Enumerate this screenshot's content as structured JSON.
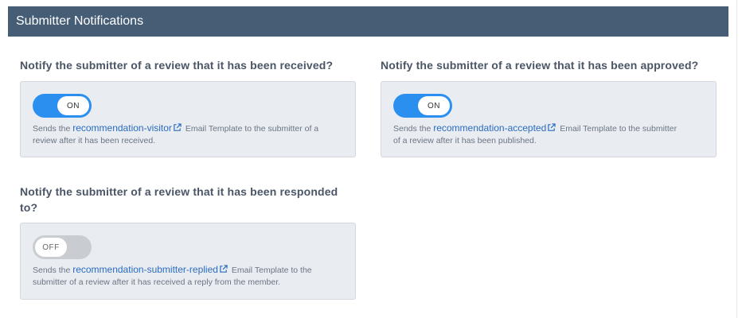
{
  "header": {
    "title": "Submitter Notifications"
  },
  "settings": [
    {
      "question": "Notify the submitter of a review that it has been received?",
      "toggle": "ON",
      "desc_before": "Sends the ",
      "link": "recommendation-visitor",
      "desc_line1_after": " Email Template to the submitter of a",
      "desc_line2": "review after it has been received."
    },
    {
      "question": "Notify the submitter of a review that it has been approved?",
      "toggle": "ON",
      "desc_before": "Sends the ",
      "link": "recommendation-accepted",
      "desc_line1_after": " Email Template to the submitter",
      "desc_line2": "of a review after it has been published."
    },
    {
      "question_line1": "Notify the submitter of a review that it has been responded",
      "question_line2": "to?",
      "toggle": "OFF",
      "desc_before": "Sends the ",
      "link": "recommendation-submitter-replied",
      "desc_line1_after": " Email Template to the",
      "desc_line2": "submitter of a review after it has received a reply from the member."
    }
  ],
  "colors": {
    "header_bg": "#465d76",
    "toggle_on": "#2b8ff0",
    "toggle_off": "#c9ccd1",
    "link": "#2a6cbf",
    "box_bg": "#e9ecf1"
  },
  "icons": [
    "external-link-icon"
  ]
}
